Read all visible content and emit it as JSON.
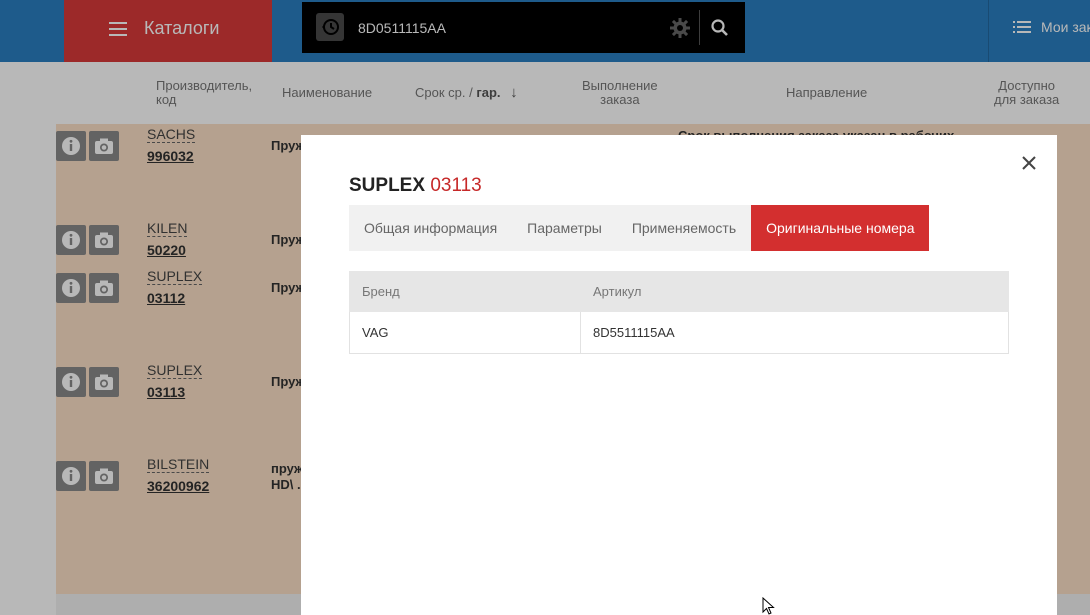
{
  "header": {
    "catalogs_label": "Каталоги",
    "search": {
      "value": "8D0511115AA"
    },
    "orders_label": "Мои заказы"
  },
  "table_header": {
    "manufacturer": [
      "Производитель,",
      "код"
    ],
    "name": "Наименование",
    "term_prefix": "Срок ср. /",
    "term_bold": "гар.",
    "fulfillment": [
      "Выполнение",
      "заказа"
    ],
    "direction": "Направление",
    "available": [
      "Доступно",
      "для заказа"
    ]
  },
  "rows": [
    {
      "brand": "SACHS",
      "code": "996032",
      "name": "Пруж",
      "notice": "Срок выполнения заказа указан в рабочих"
    },
    {
      "brand": "KILEN",
      "code": "50220",
      "name": "Пруж"
    },
    {
      "brand": "SUPLEX",
      "code": "03112",
      "name": "Пруж"
    },
    {
      "brand": "SUPLEX",
      "code": "03113",
      "name": "Пруж"
    },
    {
      "brand": "BILSTEIN",
      "code": "36200962",
      "name": "пруж",
      "name2": "HD\\ ."
    }
  ],
  "modal": {
    "title_brand": "SUPLEX",
    "title_code": "03113",
    "tabs": [
      "Общая информация",
      "Параметры",
      "Применяемость",
      "Оригинальные номера"
    ],
    "active_tab": 3,
    "columns": [
      "Бренд",
      "Артикул"
    ],
    "entries": [
      {
        "brand": "VAG",
        "article": "8D5511115AA"
      }
    ]
  },
  "colors": {
    "topbar": "#2a7fc1",
    "catalogs_button": "#d93a3a",
    "active_tab": "#d32f2f",
    "title_code": "#c62828",
    "row_highlight": "#fbe0c6"
  }
}
